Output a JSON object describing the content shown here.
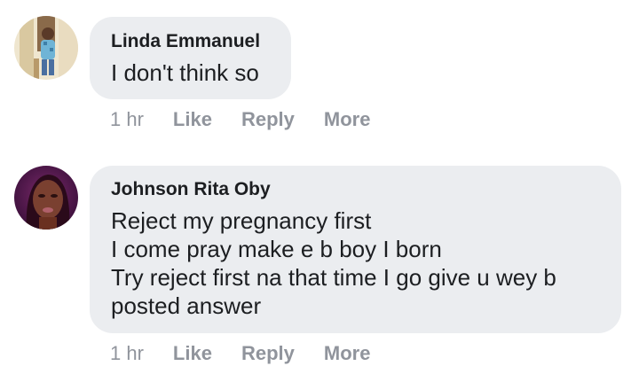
{
  "comments": [
    {
      "author": "Linda Emmanuel",
      "lines": [
        "I don't think so"
      ],
      "time": "1 hr",
      "actions": [
        "Like",
        "Reply",
        "More"
      ],
      "avatar_icon": "profile-photo-woman-standing"
    },
    {
      "author": "Johnson Rita Oby",
      "lines": [
        "Reject my pregnancy first",
        "I come pray make e b boy I born",
        "Try reject first na that time I go give u wey b",
        "posted answer"
      ],
      "time": "1 hr",
      "actions": [
        "Like",
        "Reply",
        "More"
      ],
      "avatar_icon": "profile-photo-woman-portrait"
    }
  ],
  "colors": {
    "bubble_background": "#ebedf0",
    "text": "#1c1e21",
    "meta_text": "#90949c"
  }
}
